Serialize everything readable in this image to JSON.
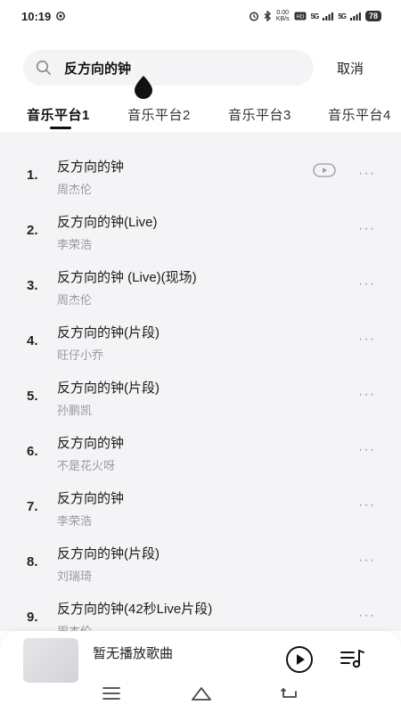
{
  "status": {
    "time": "10:19",
    "net_speed_value": "0.00",
    "net_speed_unit": "KB/s",
    "signal1": "5G",
    "signal2": "5G",
    "battery": "78"
  },
  "search": {
    "query": "反方向的钟",
    "cancel_label": "取消"
  },
  "tabs": [
    "音乐平台1",
    "音乐平台2",
    "音乐平台3",
    "音乐平台4"
  ],
  "songs": [
    {
      "num": "1.",
      "title": "反方向的钟",
      "artist": "周杰伦",
      "has_mv": true
    },
    {
      "num": "2.",
      "title": "反方向的钟(Live)",
      "artist": "李荣浩",
      "has_mv": false
    },
    {
      "num": "3.",
      "title": "反方向的钟 (Live)(现场)",
      "artist": "周杰伦",
      "has_mv": false
    },
    {
      "num": "4.",
      "title": "反方向的钟(片段)",
      "artist": "旺仔小乔",
      "has_mv": false
    },
    {
      "num": "5.",
      "title": "反方向的钟(片段)",
      "artist": "孙鹏凯",
      "has_mv": false
    },
    {
      "num": "6.",
      "title": "反方向的钟",
      "artist": "不是花火呀",
      "has_mv": false
    },
    {
      "num": "7.",
      "title": "反方向的钟",
      "artist": "李荣浩",
      "has_mv": false
    },
    {
      "num": "8.",
      "title": "反方向的钟(片段)",
      "artist": "刘瑞琦",
      "has_mv": false
    },
    {
      "num": "9.",
      "title": "反方向的钟(42秒Live片段)",
      "artist": "周杰伦",
      "has_mv": false
    }
  ],
  "more_glyph": "···",
  "player": {
    "now_playing": "暂无播放歌曲"
  }
}
